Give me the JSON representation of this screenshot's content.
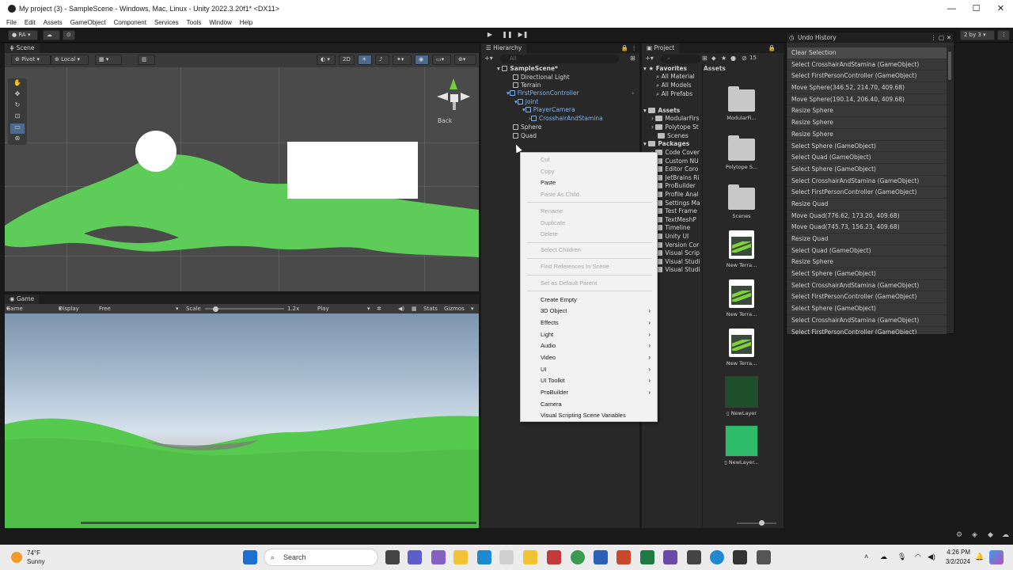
{
  "window": {
    "title": "My project (3) - SampleScene - Windows, Mac, Linux - Unity 2022.3.20f1* <DX11>",
    "controls": [
      "—",
      "☐",
      "✕"
    ]
  },
  "menu": [
    "File",
    "Edit",
    "Assets",
    "GameObject",
    "Component",
    "Services",
    "Tools",
    "Window",
    "Help"
  ],
  "toolbar": {
    "account": "RA",
    "layout": "2 by 3"
  },
  "scene": {
    "tab": "Scene",
    "pivot": "Pivot",
    "local": "Local",
    "mode_2d": "2D",
    "gizmo_back": "Back"
  },
  "game": {
    "tab": "Game",
    "mode": "Game",
    "display": "Display 1",
    "aspect": "Free Aspect",
    "scale_label": "Scale",
    "scale_value": "1.2x",
    "play_mode": "Play Focused",
    "stats": "Stats",
    "gizmos": "Gizmos"
  },
  "hierarchy": {
    "tab": "Hierarchy",
    "search_placeholder": "All",
    "items": [
      {
        "label": "SampleScene*"
      },
      {
        "label": "Directional Light"
      },
      {
        "label": "Terrain"
      },
      {
        "label": "FirstPersonController"
      },
      {
        "label": "Joint"
      },
      {
        "label": "PlayerCamera"
      },
      {
        "label": "CrosshairAndStamina"
      },
      {
        "label": "Sphere"
      },
      {
        "label": "Quad"
      }
    ]
  },
  "context_menu": {
    "items": [
      {
        "label": "Cut",
        "enabled": false
      },
      {
        "label": "Copy",
        "enabled": false
      },
      {
        "label": "Paste",
        "enabled": true
      },
      {
        "label": "Paste As Child",
        "enabled": false
      },
      {
        "label": "Rename",
        "enabled": false
      },
      {
        "label": "Duplicate",
        "enabled": false
      },
      {
        "label": "Delete",
        "enabled": false
      },
      {
        "label": "Select Children",
        "enabled": false
      },
      {
        "label": "Find References In Scene",
        "enabled": false
      },
      {
        "label": "Set as Default Parent",
        "enabled": false
      },
      {
        "label": "Create Empty",
        "enabled": true
      },
      {
        "label": "3D Object",
        "enabled": true,
        "submenu": true
      },
      {
        "label": "Effects",
        "enabled": true,
        "submenu": true
      },
      {
        "label": "Light",
        "enabled": true,
        "submenu": true
      },
      {
        "label": "Audio",
        "enabled": true,
        "submenu": true
      },
      {
        "label": "Video",
        "enabled": true,
        "submenu": true
      },
      {
        "label": "UI",
        "enabled": true,
        "submenu": true
      },
      {
        "label": "UI Toolkit",
        "enabled": true,
        "submenu": true
      },
      {
        "label": "ProBuilder",
        "enabled": true,
        "submenu": true
      },
      {
        "label": "Camera",
        "enabled": true
      },
      {
        "label": "Visual Scripting Scene Variables",
        "enabled": true
      }
    ]
  },
  "project": {
    "tab": "Project",
    "count": "15",
    "favorites": {
      "label": "Favorites",
      "items": [
        "All Material",
        "All Models",
        "All Prefabs"
      ]
    },
    "assets": {
      "label": "Assets",
      "items": [
        "ModularFirs",
        "Polytope St",
        "Scenes"
      ]
    },
    "packages": {
      "label": "Packages",
      "items": [
        "Code Cover",
        "Custom NU",
        "Editor Coro",
        "JetBrains Ri",
        "ProBuilder",
        "Profile Anal",
        "Settings Ma",
        "Test Frame",
        "TextMeshP",
        "Timeline",
        "Unity UI",
        "Version Cor",
        "Visual Scrip",
        "Visual Studi",
        "Visual Studi"
      ]
    },
    "grid_header": "Assets",
    "tiles": [
      "ModularFi...",
      "Polytope S...",
      "Scenes",
      "New Terra...",
      "New Terra...",
      "New Terra...",
      "NewLayer",
      "NewLayer..."
    ]
  },
  "undo_history": {
    "title": "Undo History",
    "items": [
      "Clear Selection",
      "Select CrosshairAndStamina (GameObject)",
      "Select FirstPersonController (GameObject)",
      "Move Sphere(346.52, 214.70, 409.68)",
      "Move Sphere(190.14, 206.40, 409.68)",
      "Resize Sphere",
      "Resize Sphere",
      "Resize Sphere",
      "Select Sphere (GameObject)",
      "Select Quad (GameObject)",
      "Select Sphere (GameObject)",
      "Select CrosshairAndStamina (GameObject)",
      "Select FirstPersonController (GameObject)",
      "Resize Quad",
      "Move Quad(776.62, 173.20, 409.68)",
      "Move Quad(745.73, 156.23, 409.68)",
      "Resize Quad",
      "Select Quad (GameObject)",
      "Resize Sphere",
      "Select Sphere (GameObject)",
      "Select CrosshairAndStamina (GameObject)",
      "Select FirstPersonController (GameObject)",
      "Select Sphere (GameObject)",
      "Select CrosshairAndStamina (GameObject)",
      "Select FirstPersonController (GameObject)"
    ]
  },
  "taskbar": {
    "weather_temp": "74°F",
    "weather_desc": "Sunny",
    "search": "Search",
    "time": "4:26 PM",
    "date": "3/2/2024"
  },
  "colors": {
    "terrain_green": "#5fd35a",
    "editor_bg": "#282828",
    "selection_blue": "#4d6a8e"
  }
}
